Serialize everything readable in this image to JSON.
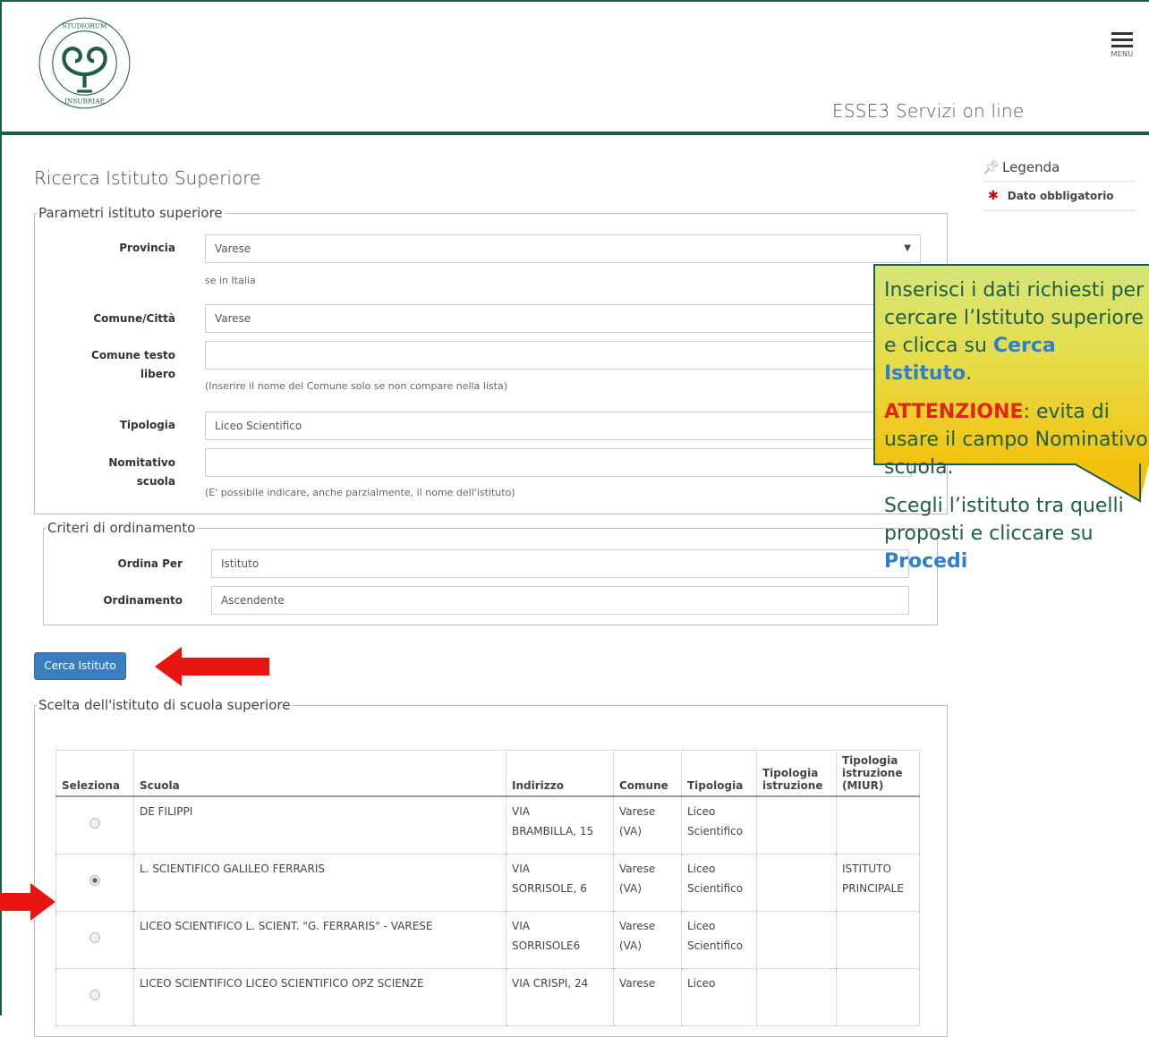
{
  "header": {
    "app_title": "ESSE3 Servizi on line",
    "menu_label": "MENU",
    "logo_alt": "UNIVERSITAS STUDIORUM INSUBRIAE"
  },
  "legenda": {
    "title": "Legenda",
    "required": "Dato obbligatorio"
  },
  "page_title": "Ricerca Istituto Superiore",
  "parametri": {
    "legend": "Parametri istituto superiore",
    "provincia": {
      "label": "Provincia",
      "value": "Varese",
      "hint": "se in Italia"
    },
    "comune": {
      "label": "Comune/Città",
      "value": "Varese"
    },
    "comune_libero": {
      "label_1": "Comune testo",
      "label_2": "libero",
      "value": "",
      "hint": "(Inserire il nome del Comune solo se non compare nella lista)"
    },
    "tipologia": {
      "label": "Tipologia",
      "value": "Liceo Scientifico"
    },
    "nominativo": {
      "label_1": "Nomitativo",
      "label_2": "scuola",
      "value": "",
      "hint": "(E' possibile indicare, anche parzialmente, il nome dell'istituto)"
    }
  },
  "criteri": {
    "legend": "Criteri di ordinamento",
    "ordina_per": {
      "label": "Ordina Per",
      "value": "Istituto"
    },
    "ordinamento": {
      "label": "Ordinamento",
      "value": "Ascendente"
    }
  },
  "cerca_button": "Cerca Istituto",
  "scelta": {
    "legend": "Scelta dell'istituto di scuola superiore",
    "headers": {
      "seleziona": "Seleziona",
      "scuola": "Scuola",
      "indirizzo": "Indirizzo",
      "comune": "Comune",
      "tipologia": "Tipologia",
      "tip_istr_1": "Tipologia",
      "tip_istr_2": "istruzione",
      "miur_1": "Tipologia",
      "miur_2": "istruzione",
      "miur_3": "(MIUR)"
    },
    "rows": [
      {
        "selected": false,
        "scuola": "DE FILIPPI",
        "ind_1": "VIA",
        "ind_2": "BRAMBILLA, 15",
        "com_1": "Varese",
        "com_2": "(VA)",
        "tip_1": "Liceo",
        "tip_2": "Scientifico",
        "tip_istr": "",
        "miur_1": "",
        "miur_2": ""
      },
      {
        "selected": true,
        "scuola": "L. SCIENTIFICO GALILEO FERRARIS",
        "ind_1": "VIA",
        "ind_2": "SORRISOLE, 6",
        "com_1": "Varese",
        "com_2": "(VA)",
        "tip_1": "Liceo",
        "tip_2": "Scientifico",
        "tip_istr": "",
        "miur_1": "ISTITUTO",
        "miur_2": "PRINCIPALE"
      },
      {
        "selected": false,
        "scuola": "LICEO SCIENTIFICO L. SCIENT. \"G. FERRARIS\" - VARESE",
        "ind_1": "VIA",
        "ind_2": "SORRISOLE6",
        "com_1": "Varese",
        "com_2": "(VA)",
        "tip_1": "Liceo",
        "tip_2": "Scientifico",
        "tip_istr": "",
        "miur_1": "",
        "miur_2": ""
      },
      {
        "selected": false,
        "scuola": "LICEO SCIENTIFICO LICEO SCIENTIFICO OPZ SCIENZE",
        "ind_1": "VIA CRISPI, 24",
        "ind_2": "",
        "com_1": "Varese",
        "com_2": "",
        "tip_1": "Liceo",
        "tip_2": "",
        "tip_istr": "",
        "miur_1": "",
        "miur_2": ""
      }
    ]
  },
  "callout": {
    "p1_a": "Inserisci i dati richiesti per cercare l’Istituto superiore e clicca su ",
    "p1_link": "Cerca Istituto",
    "p1_end": ".",
    "p2_warn": "ATTENZIONE",
    "p2_rest": ": evita di usare il campo Nominativo scuola.",
    "p3_a": "Scegli l’istituto tra quelli proposti e cliccare su ",
    "p3_link": "Procedi"
  },
  "colors": {
    "brand_green": "#1f5e46",
    "button_blue": "#3b7ec0",
    "arrow_red": "#e8140f",
    "highlight_blue": "#2f7fd0",
    "warn_red": "#e0261b"
  }
}
